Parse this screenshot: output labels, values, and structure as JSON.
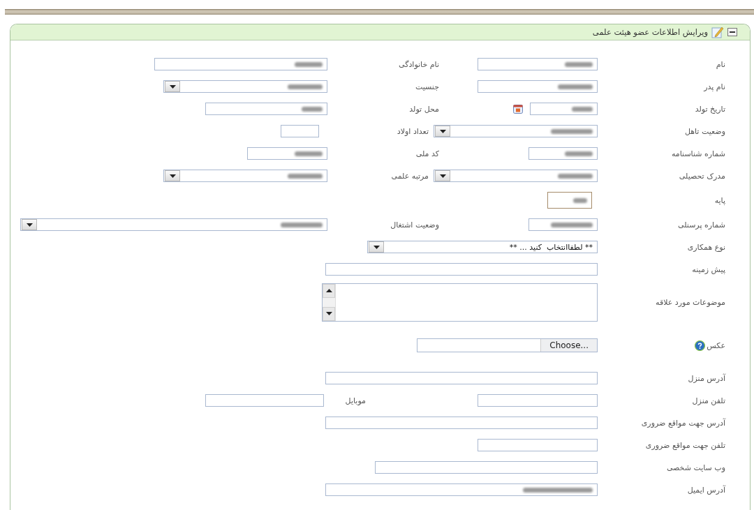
{
  "panel": {
    "title": "ویرایش اطلاعات عضو هیئت علمی",
    "collapsed": false
  },
  "rows": [
    {
      "fields": [
        {
          "label": "نام",
          "kind": "text",
          "redacted": true
        },
        {
          "label": "نام خانوادگی",
          "kind": "text",
          "redacted": true
        }
      ]
    },
    {
      "fields": [
        {
          "label": "نام پدر",
          "kind": "text",
          "redacted": true
        },
        {
          "label": "جنسیت",
          "kind": "select",
          "redacted": true
        }
      ]
    },
    {
      "fields": [
        {
          "label": "تاریخ تولد",
          "kind": "date",
          "redacted": true
        },
        {
          "label": "محل تولد",
          "kind": "text",
          "redacted": true
        }
      ]
    },
    {
      "fields": [
        {
          "label": "وضعیت تاهل",
          "kind": "select",
          "redacted": true
        },
        {
          "label": "تعداد اولاد",
          "kind": "text",
          "redacted": false
        }
      ]
    },
    {
      "fields": [
        {
          "label": "شماره شناسنامه",
          "kind": "text",
          "redacted": true
        },
        {
          "label": "کد ملی",
          "kind": "text",
          "redacted": true
        }
      ]
    },
    {
      "fields": [
        {
          "label": "مدرک تحصیلی",
          "kind": "select",
          "redacted": true
        },
        {
          "label": "مرتبه علمی",
          "kind": "select",
          "redacted": true
        }
      ]
    },
    {
      "fields": [
        {
          "label": "پایه",
          "kind": "readonly",
          "redacted": true
        }
      ]
    },
    {
      "fields": [
        {
          "label": "شماره پرسنلی",
          "kind": "text",
          "redacted": true
        },
        {
          "label": "وضعیت اشتغال",
          "kind": "select",
          "redacted": true
        }
      ]
    },
    {
      "fields": [
        {
          "label": "نوع همکاری",
          "kind": "select",
          "value": "** لطفاانتخاب  کنید ... **"
        }
      ]
    },
    {
      "fields": [
        {
          "label": "پیش زمینه",
          "kind": "text",
          "redacted": false
        }
      ]
    },
    {
      "fields": [
        {
          "label": "موضوعات مورد علاقه",
          "kind": "textarea"
        }
      ]
    },
    {
      "fields": [
        {
          "label": "عکس",
          "kind": "file",
          "button": "Choose...",
          "help": true
        }
      ]
    },
    {
      "fields": [
        {
          "label": "آدرس منزل",
          "kind": "text",
          "redacted": false
        }
      ]
    },
    {
      "fields": [
        {
          "label": "تلفن منزل",
          "kind": "text",
          "redacted": false
        },
        {
          "label": "موبایل",
          "kind": "text",
          "redacted": false
        }
      ]
    },
    {
      "fields": [
        {
          "label": "آدرس جهت مواقع ضروری",
          "kind": "text",
          "redacted": false
        }
      ]
    },
    {
      "fields": [
        {
          "label": "تلفن جهت مواقع ضروری",
          "kind": "text",
          "redacted": false
        }
      ]
    },
    {
      "fields": [
        {
          "label": "وب سایت شخصی",
          "kind": "text",
          "redacted": false
        }
      ]
    },
    {
      "fields": [
        {
          "label": "آدرس ایمیل",
          "kind": "text",
          "redacted": true
        }
      ]
    }
  ]
}
